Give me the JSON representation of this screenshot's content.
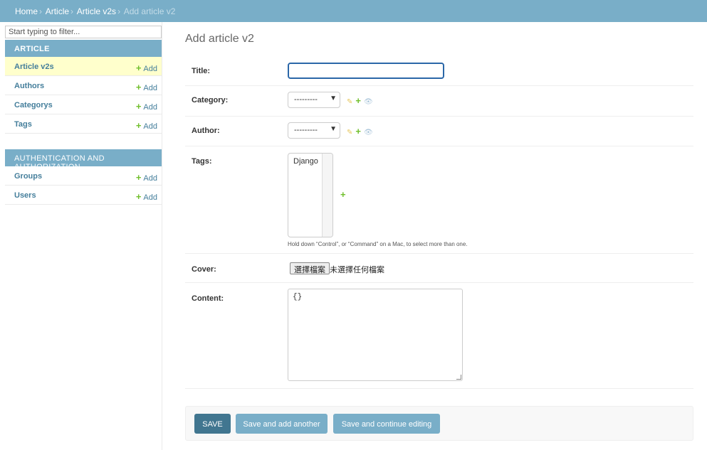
{
  "breadcrumbs": {
    "home": "Home",
    "app": "Article",
    "model": "Article v2s",
    "current": "Add article v2",
    "separator": "›"
  },
  "sidebar": {
    "filter_placeholder": "Start typing to filter...",
    "apps": [
      {
        "title": "ARTICLE",
        "models": [
          {
            "name": "Article v2s",
            "add": "Add",
            "active": true
          },
          {
            "name": "Authors",
            "add": "Add"
          },
          {
            "name": "Categorys",
            "add": "Add"
          },
          {
            "name": "Tags",
            "add": "Add"
          }
        ]
      },
      {
        "title": "AUTHENTICATION AND AUTHORIZATION",
        "models": [
          {
            "name": "Groups",
            "add": "Add"
          },
          {
            "name": "Users",
            "add": "Add"
          }
        ]
      }
    ]
  },
  "main": {
    "title": "Add article v2",
    "fields": {
      "title": {
        "label": "Title:",
        "value": ""
      },
      "category": {
        "label": "Category:",
        "selected": "---------"
      },
      "author": {
        "label": "Author:",
        "selected": "---------"
      },
      "tags": {
        "label": "Tags:",
        "options": [
          "Django"
        ],
        "help": "Hold down “Control”, or “Command” on a Mac, to select more than one."
      },
      "cover": {
        "label": "Cover:",
        "button": "選擇檔案",
        "status": "未選擇任何檔案"
      },
      "content": {
        "label": "Content:",
        "value": "{}"
      }
    }
  },
  "submit": {
    "save": "SAVE",
    "save_add_another": "Save and add another",
    "save_continue": "Save and continue editing"
  },
  "icons": {
    "add": "+",
    "change": "✎",
    "view": "👁"
  },
  "colors": {
    "header": "#79aec8",
    "link": "#447e9b",
    "active_row": "#ffffcc",
    "add_green": "#70bf2b",
    "save_button": "#417690"
  }
}
